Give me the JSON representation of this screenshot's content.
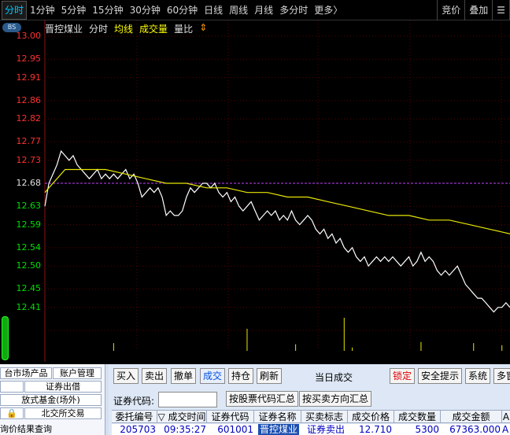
{
  "periods": [
    "分时",
    "1分钟",
    "5分钟",
    "15分钟",
    "30分钟",
    "60分钟",
    "日线",
    "周线",
    "月线",
    "多分时",
    "更多〉"
  ],
  "topright": [
    "竞价",
    "叠加",
    "☰"
  ],
  "chart_head": {
    "badge": "BS",
    "name": "晋控煤业",
    "fs": "分时",
    "avg": "均线",
    "vol": "成交量",
    "ratio": "量比",
    "arrow": "⇕"
  },
  "chart_data": {
    "type": "line",
    "yticks": [
      "13.00",
      "12.95",
      "12.91",
      "12.86",
      "12.82",
      "12.77",
      "12.73",
      "12.68",
      "12.63",
      "12.59",
      "12.54",
      "12.50",
      "12.45",
      "12.41"
    ],
    "ylim": [
      12.36,
      13.0
    ],
    "prev_close": 12.68,
    "series": [
      {
        "points": [
          [
            0,
            12.63
          ],
          [
            1,
            12.68
          ],
          [
            2,
            12.7
          ],
          [
            3,
            12.72
          ],
          [
            4,
            12.75
          ],
          [
            5,
            12.74
          ],
          [
            6,
            12.73
          ],
          [
            7,
            12.74
          ],
          [
            8,
            12.72
          ],
          [
            9,
            12.71
          ],
          [
            10,
            12.7
          ],
          [
            11,
            12.69
          ],
          [
            12,
            12.7
          ],
          [
            13,
            12.71
          ],
          [
            14,
            12.69
          ],
          [
            15,
            12.7
          ],
          [
            16,
            12.69
          ],
          [
            17,
            12.7
          ],
          [
            18,
            12.69
          ],
          [
            19,
            12.7
          ],
          [
            20,
            12.71
          ],
          [
            21,
            12.69
          ],
          [
            22,
            12.7
          ],
          [
            23,
            12.68
          ],
          [
            24,
            12.65
          ],
          [
            25,
            12.66
          ],
          [
            26,
            12.67
          ],
          [
            27,
            12.66
          ],
          [
            28,
            12.67
          ],
          [
            29,
            12.65
          ],
          [
            30,
            12.61
          ],
          [
            31,
            12.62
          ],
          [
            32,
            12.61
          ],
          [
            33,
            12.61
          ],
          [
            34,
            12.62
          ],
          [
            35,
            12.65
          ],
          [
            36,
            12.67
          ],
          [
            37,
            12.66
          ],
          [
            38,
            12.67
          ],
          [
            39,
            12.68
          ],
          [
            40,
            12.68
          ],
          [
            41,
            12.67
          ],
          [
            42,
            12.68
          ],
          [
            43,
            12.66
          ],
          [
            44,
            12.65
          ],
          [
            45,
            12.66
          ],
          [
            46,
            12.64
          ],
          [
            47,
            12.65
          ],
          [
            48,
            12.63
          ],
          [
            49,
            12.62
          ],
          [
            50,
            12.63
          ],
          [
            51,
            12.64
          ],
          [
            52,
            12.62
          ],
          [
            53,
            12.6
          ],
          [
            54,
            12.61
          ],
          [
            55,
            12.62
          ],
          [
            56,
            12.61
          ],
          [
            57,
            12.62
          ],
          [
            58,
            12.6
          ],
          [
            59,
            12.61
          ],
          [
            60,
            12.6
          ],
          [
            61,
            12.62
          ],
          [
            62,
            12.6
          ],
          [
            63,
            12.59
          ],
          [
            64,
            12.6
          ],
          [
            65,
            12.61
          ],
          [
            66,
            12.6
          ],
          [
            67,
            12.58
          ],
          [
            68,
            12.57
          ],
          [
            69,
            12.58
          ],
          [
            70,
            12.56
          ],
          [
            71,
            12.57
          ],
          [
            72,
            12.55
          ],
          [
            73,
            12.56
          ],
          [
            74,
            12.54
          ],
          [
            75,
            12.53
          ],
          [
            76,
            12.54
          ],
          [
            77,
            12.52
          ],
          [
            78,
            12.51
          ],
          [
            79,
            12.52
          ],
          [
            80,
            12.5
          ],
          [
            81,
            12.51
          ],
          [
            82,
            12.52
          ],
          [
            83,
            12.51
          ],
          [
            84,
            12.52
          ],
          [
            85,
            12.51
          ],
          [
            86,
            12.52
          ],
          [
            87,
            12.51
          ],
          [
            88,
            12.5
          ],
          [
            89,
            12.51
          ],
          [
            90,
            12.52
          ],
          [
            91,
            12.5
          ],
          [
            92,
            12.51
          ],
          [
            93,
            12.53
          ],
          [
            94,
            12.51
          ],
          [
            95,
            12.52
          ],
          [
            96,
            12.51
          ],
          [
            97,
            12.49
          ],
          [
            98,
            12.48
          ],
          [
            99,
            12.49
          ],
          [
            100,
            12.48
          ],
          [
            101,
            12.49
          ],
          [
            102,
            12.5
          ],
          [
            103,
            12.48
          ],
          [
            104,
            12.46
          ],
          [
            105,
            12.45
          ],
          [
            106,
            12.44
          ],
          [
            107,
            12.43
          ],
          [
            108,
            12.43
          ],
          [
            109,
            12.42
          ],
          [
            110,
            12.41
          ],
          [
            111,
            12.4
          ],
          [
            112,
            12.41
          ],
          [
            113,
            12.41
          ],
          [
            114,
            12.42
          ],
          [
            115,
            12.41
          ]
        ]
      },
      {
        "points": [
          [
            0,
            12.66
          ],
          [
            5,
            12.71
          ],
          [
            10,
            12.71
          ],
          [
            15,
            12.71
          ],
          [
            20,
            12.7
          ],
          [
            25,
            12.69
          ],
          [
            30,
            12.68
          ],
          [
            35,
            12.68
          ],
          [
            40,
            12.67
          ],
          [
            45,
            12.67
          ],
          [
            50,
            12.66
          ],
          [
            55,
            12.66
          ],
          [
            60,
            12.65
          ],
          [
            65,
            12.65
          ],
          [
            70,
            12.64
          ],
          [
            75,
            12.63
          ],
          [
            80,
            12.62
          ],
          [
            85,
            12.61
          ],
          [
            90,
            12.61
          ],
          [
            95,
            12.6
          ],
          [
            100,
            12.6
          ],
          [
            105,
            12.59
          ],
          [
            110,
            12.58
          ],
          [
            115,
            12.57
          ]
        ]
      }
    ],
    "volume_bars": [
      [
        17,
        14
      ],
      [
        50,
        40
      ],
      [
        62,
        12
      ],
      [
        74,
        60
      ],
      [
        76,
        6
      ],
      [
        93,
        16
      ],
      [
        106,
        14
      ],
      [
        113,
        10
      ]
    ]
  },
  "leftnav": {
    "r1a": "台市场产品",
    "r1b": "账户管理",
    "r2": "证券出借",
    "r3": "放式基金(场外)",
    "r4a": "🔒",
    "r4b": "北交所交易",
    "r5": "询价结果查询"
  },
  "toolbar": {
    "buy": "买入",
    "sell": "卖出",
    "cancel": "撤单",
    "deal": "成交",
    "hold": "持仓",
    "refresh": "刷新",
    "title": "当日成交",
    "lock": "锁定",
    "safety": "安全提示",
    "system": "系统",
    "more": "多窗"
  },
  "form": {
    "code_label": "证券代码:",
    "code_value": "",
    "by_code": "按股票代码汇总",
    "by_side": "按买卖方向汇总"
  },
  "table": {
    "headers": [
      "委托编号",
      "▽ 成交时间",
      "证券代码",
      "证券名称",
      "买卖标志",
      "成交价格",
      "成交数量",
      "成交金额",
      "A"
    ],
    "rows": [
      [
        "205703",
        "09:35:27",
        "601001",
        "晋控煤业",
        "证券卖出",
        "12.710",
        "5300",
        "67363.000",
        "A"
      ]
    ]
  }
}
